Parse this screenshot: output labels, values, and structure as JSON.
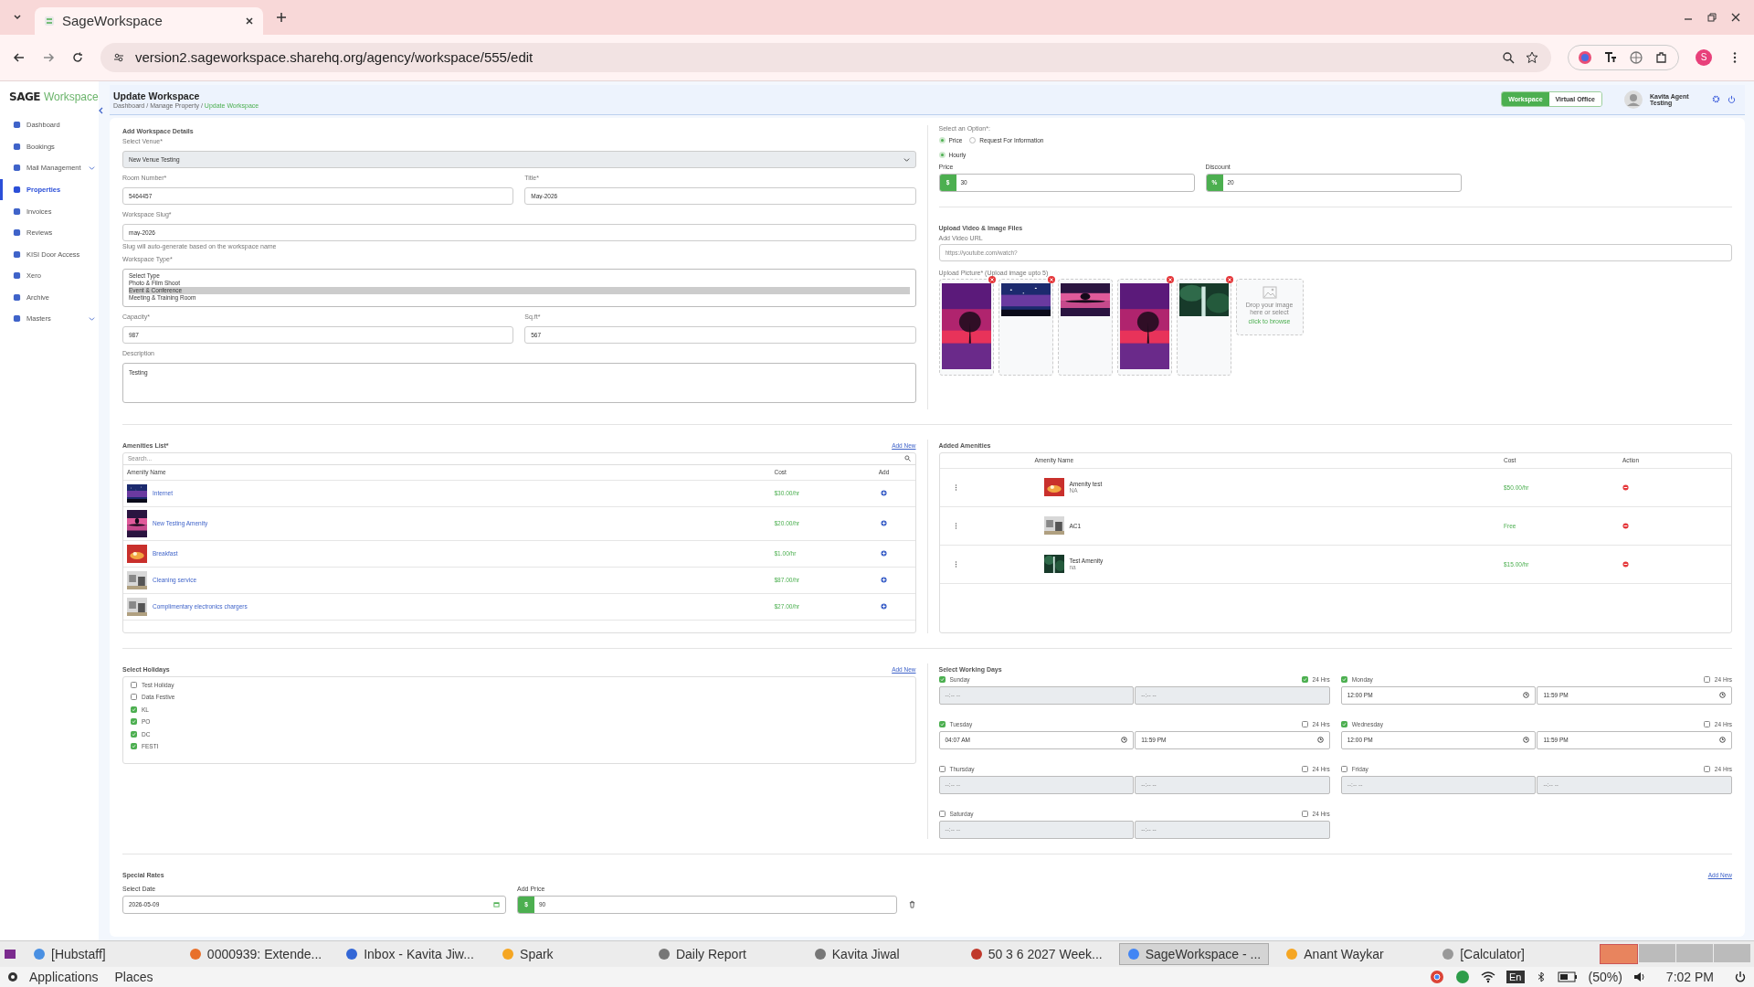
{
  "browser": {
    "tab_title": "SageWorkspace",
    "url": "version2.sageworkspace.sharehq.org/agency/workspace/555/edit",
    "profile_initial": "S"
  },
  "sidebar": {
    "logo_bold": "SAGE",
    "logo_light": "Workspace",
    "items": [
      {
        "label": "Dashboard",
        "selected": false,
        "expandable": false
      },
      {
        "label": "Bookings",
        "selected": false,
        "expandable": false
      },
      {
        "label": "Mail Management",
        "selected": false,
        "expandable": true
      },
      {
        "label": "Properties",
        "selected": true,
        "expandable": false
      },
      {
        "label": "Invoices",
        "selected": false,
        "expandable": false
      },
      {
        "label": "Reviews",
        "selected": false,
        "expandable": false
      },
      {
        "label": "KISI Door Access",
        "selected": false,
        "expandable": false
      },
      {
        "label": "Xero",
        "selected": false,
        "expandable": false
      },
      {
        "label": "Archive",
        "selected": false,
        "expandable": false
      },
      {
        "label": "Masters",
        "selected": false,
        "expandable": true
      }
    ]
  },
  "header": {
    "title": "Update Workspace",
    "breadcrumb_separator": "/",
    "breadcrumbs": [
      {
        "label": "Dashboard",
        "current": false
      },
      {
        "label": "Manage Property",
        "current": false
      },
      {
        "label": "Update Workspace",
        "current": true
      }
    ],
    "mode_tabs": [
      {
        "label": "Workspace",
        "selected": true
      },
      {
        "label": "Virtual Office",
        "selected": false
      }
    ],
    "user": {
      "name": "Kavita Agent",
      "role": "Testing"
    }
  },
  "details": {
    "title": "Add Workspace Details",
    "rows": [
      [
        {
          "kind": "select",
          "label": "Select Venue*",
          "value": "New Venue Testing"
        }
      ],
      [
        {
          "kind": "text",
          "label": "Room Number*",
          "value": "5464457"
        },
        {
          "kind": "text",
          "label": "Title*",
          "value": "May-2026"
        }
      ],
      [
        {
          "kind": "text",
          "label": "Workspace Slug*",
          "value": "may-2026",
          "hint": "Slug will auto-generate based on the workspace name"
        }
      ],
      [
        {
          "kind": "listbox",
          "label": "Workspace Type*",
          "options": [
            {
              "label": "Select Type",
              "selected": false
            },
            {
              "label": "Photo & Film Shoot",
              "selected": false
            },
            {
              "label": "Event & Conference",
              "selected": true
            },
            {
              "label": "Meeting & Training Room",
              "selected": false
            }
          ]
        }
      ],
      [
        {
          "kind": "text",
          "label": "Capacity*",
          "value": "987"
        },
        {
          "kind": "text",
          "label": "Sq.ft*",
          "value": "567"
        }
      ],
      [
        {
          "kind": "textarea",
          "label": "Description",
          "value": "Testing"
        }
      ]
    ]
  },
  "pricing": {
    "title": "Select an Option*:",
    "options": [
      {
        "label": "Price",
        "selected": true
      },
      {
        "label": "Request For Information",
        "selected": false
      }
    ],
    "rate_options": [
      {
        "label": "Hourly",
        "selected": true
      }
    ],
    "fields": [
      {
        "label": "Price",
        "prefix": "$",
        "value": "30"
      },
      {
        "label": "Discount",
        "prefix": "%",
        "value": "20"
      }
    ]
  },
  "media": {
    "title": "Upload Video & Image Files",
    "video_label": "Add Video URL",
    "video_placeholder": "https://youtube.com/watch?",
    "picture_label": "Upload Picture* (Upload image upto 5)",
    "images": [
      {
        "kind": "picture",
        "portrait": true,
        "removable": true
      },
      {
        "kind": "picture",
        "portrait": false,
        "removable": true
      },
      {
        "kind": "picture",
        "portrait": false,
        "removable": false
      },
      {
        "kind": "picture",
        "portrait": true,
        "removable": true
      },
      {
        "kind": "picture",
        "portrait": false,
        "removable": true
      }
    ],
    "drop_text": "Drop your image here or select",
    "browse_link": "click to browse"
  },
  "amenities": {
    "title": "Amenities List*",
    "add_new": "Add New",
    "search_placeholder": "Search...",
    "columns": [
      "Amenity Name",
      "Cost",
      "Add"
    ],
    "rows": [
      {
        "name": "Internet",
        "cost": "$30.00/hr"
      },
      {
        "name": "New Testing Amenity",
        "cost": "$20.00/hr"
      },
      {
        "name": "Breakfast",
        "cost": "$1.00/hr"
      },
      {
        "name": "Cleaning service",
        "cost": "$87.00/hr"
      },
      {
        "name": "Complimentary electronics chargers",
        "cost": "$27.00/hr"
      }
    ]
  },
  "added_amenities": {
    "title": "Added Amenities",
    "columns": [
      "Amenity Name",
      "Cost",
      "Action"
    ],
    "rows": [
      {
        "name": "Amenity test",
        "note": "NA",
        "cost": "$50.00/hr"
      },
      {
        "name": "AC1",
        "cost": "Free"
      },
      {
        "name": "Test Amenity",
        "note": "na",
        "cost": "$15.00/hr"
      }
    ]
  },
  "holidays": {
    "title": "Select Holidays",
    "add_new": "Add New",
    "items": [
      {
        "label": "Test Holiday",
        "checked": false
      },
      {
        "label": "Data Festive",
        "checked": false
      },
      {
        "label": "KL",
        "checked": true
      },
      {
        "label": "PO",
        "checked": true
      },
      {
        "label": "DC",
        "checked": true
      },
      {
        "label": "FESTI",
        "checked": true
      }
    ]
  },
  "working_days": {
    "title": "Select Working Days",
    "days": [
      {
        "name": "Sunday",
        "checked": true,
        "all_day_label": "24 Hrs",
        "all_day": true,
        "start_placeholder": "--:-- --",
        "end_placeholder": "--:-- --"
      },
      {
        "name": "Monday",
        "checked": true,
        "all_day_label": "24 Hrs",
        "all_day": false,
        "start": "12:00 PM",
        "end": "11:59 PM"
      },
      {
        "name": "Tuesday",
        "checked": true,
        "all_day_label": "24 Hrs",
        "all_day": false,
        "start": "04:07 AM",
        "end": "11:59 PM"
      },
      {
        "name": "Wednesday",
        "checked": true,
        "all_day_label": "24 Hrs",
        "all_day": false,
        "start": "12:00 PM",
        "end": "11:59 PM"
      },
      {
        "name": "Thursday",
        "checked": false,
        "all_day_label": "24 Hrs",
        "all_day": false,
        "start_placeholder": "--:-- --",
        "end_placeholder": "--:-- --"
      },
      {
        "name": "Friday",
        "checked": false,
        "all_day_label": "24 Hrs",
        "all_day": false,
        "start_placeholder": "--:-- --",
        "end_placeholder": "--:-- --"
      },
      {
        "name": "Saturday",
        "checked": false,
        "all_day_label": "24 Hrs",
        "all_day": false,
        "start_placeholder": "--:-- --",
        "end_placeholder": "--:-- --"
      }
    ]
  },
  "special_rates": {
    "title": "Special Rates",
    "add_new": "Add New",
    "date_label": "Select Date",
    "date": "2026-05-09",
    "price_label": "Add Price",
    "prefix": "$",
    "price": "90"
  },
  "taskbar": {
    "items": [
      {
        "label": "[Hubstaff]",
        "selected": false
      },
      {
        "label": "0000939: Extende...",
        "selected": false
      },
      {
        "label": "Inbox - Kavita Jiw...",
        "selected": false
      },
      {
        "label": "Spark",
        "selected": false
      },
      {
        "label": "Daily Report",
        "selected": false
      },
      {
        "label": "Kavita Jiwal",
        "selected": false
      },
      {
        "label": "50 3 6 2027 Week...",
        "selected": false
      },
      {
        "label": "SageWorkspace - ...",
        "selected": true
      },
      {
        "label": "Anant Waykar",
        "selected": false
      },
      {
        "label": "[Calculator]",
        "selected": false
      }
    ]
  },
  "panel": {
    "menus": [
      "Applications",
      "Places"
    ],
    "keyboard": "En",
    "battery": "(50%)",
    "clock": "7:02 PM"
  }
}
